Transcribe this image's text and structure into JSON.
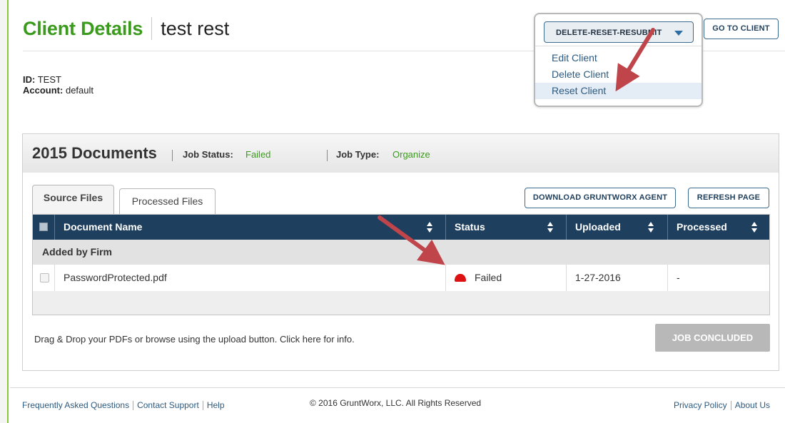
{
  "header": {
    "title": "Client Details",
    "client_name": "test rest",
    "id_label": "ID:",
    "id_value": "TEST",
    "account_label": "Account:",
    "account_value": "default"
  },
  "actions": {
    "dropdown_label": "DELETE-RESET-RESUBMIT",
    "go_to_client": "GO TO CLIENT",
    "menu": [
      "Edit Client",
      "Delete Client",
      "Reset Client"
    ],
    "active_item": "Reset Client"
  },
  "documents": {
    "year": "2015",
    "title": "Documents",
    "job_status_label": "Job Status:",
    "job_status_value": "Failed",
    "job_type_label": "Job Type:",
    "job_type_value": "Organize",
    "tabs": [
      "Source Files",
      "Processed Files"
    ],
    "download_agent": "DOWNLOAD GRUNTWORX AGENT",
    "refresh": "REFRESH PAGE",
    "columns": [
      "Document Name",
      "Status",
      "Uploaded",
      "Processed"
    ],
    "group_label": "Added by Firm",
    "rows": [
      {
        "name": "PasswordProtected.pdf",
        "status": "Failed",
        "uploaded": "1-27-2016",
        "processed": "-"
      }
    ],
    "drop_hint": "Drag & Drop your PDFs or browse using the upload button. Click here for info.",
    "job_concluded": "JOB CONCLUDED"
  },
  "footer": {
    "faq": "Frequently Asked Questions",
    "contact": "Contact Support",
    "help": "Help",
    "copyright": "© 2016 GruntWorx, LLC. All Rights Reserved",
    "privacy": "Privacy Policy",
    "about": "About Us"
  },
  "colors": {
    "brand_green": "#3a9a1b",
    "grid_header": "#1e3f5e",
    "failed_red": "#dd1111",
    "annotation_arrow": "#c0454a"
  },
  "icons": [
    "caret-down-icon",
    "sort-icon",
    "warning-icon",
    "checkbox-icon",
    "arrow-annotation"
  ]
}
